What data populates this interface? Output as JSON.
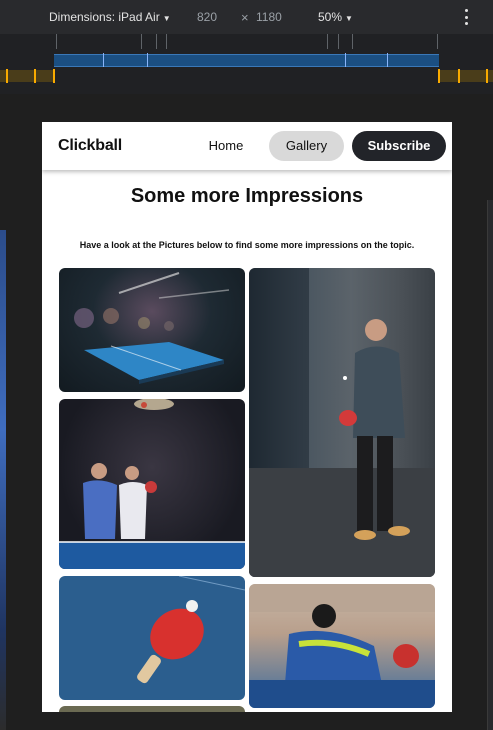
{
  "devtools": {
    "dimensions_label": "Dimensions: iPad Air",
    "width_value": "820",
    "times_symbol": "×",
    "height_value": "1180",
    "zoom_label": "50%"
  },
  "site": {
    "brand": "Clickball",
    "nav": {
      "home": "Home",
      "gallery": "Gallery",
      "subscribe": "Subscribe"
    },
    "heading": "Some more Impressions",
    "subheading": "Have a look at the Pictures below to find some more impressions on the topic."
  },
  "gallery": {
    "images": [
      {
        "subject": "table-tennis-hall"
      },
      {
        "subject": "player-portrait"
      },
      {
        "subject": "doubles-players"
      },
      {
        "subject": "paddle-and-ball"
      },
      {
        "subject": "match-player"
      },
      {
        "subject": "cropped-image"
      }
    ]
  },
  "colors": {
    "nav_active_bg": "#d9d9d9",
    "subscribe_bg": "#222429",
    "devtools_bg": "#292a2d"
  }
}
